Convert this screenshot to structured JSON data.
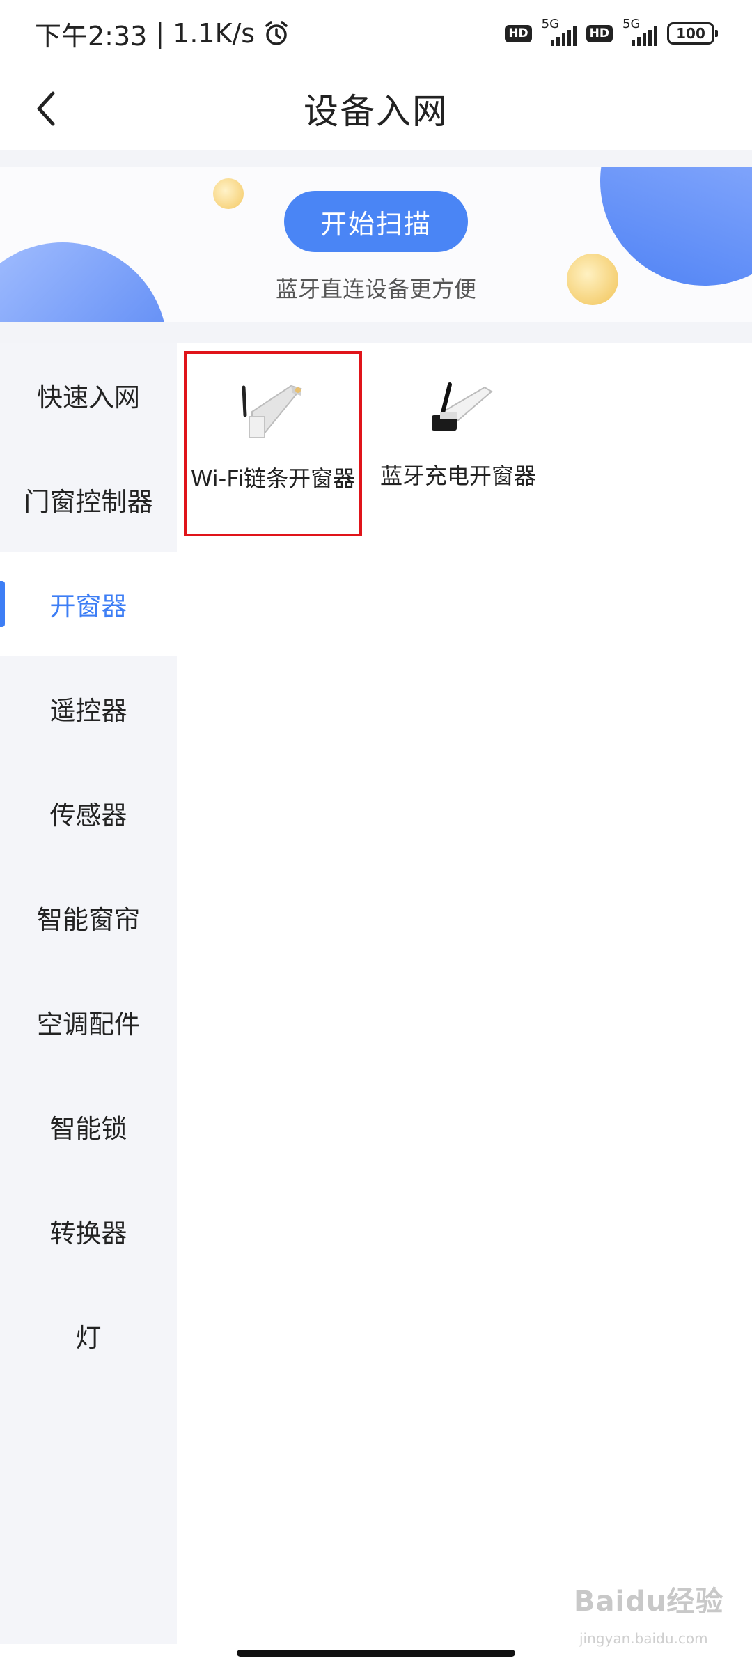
{
  "status_bar": {
    "time": "下午2:33",
    "separator": "|",
    "net_speed": "1.1K/s",
    "hd1": "HD",
    "net1": "5G",
    "hd2": "HD",
    "net2": "5G",
    "battery": "100",
    "icons": [
      "alarm-icon",
      "signal-icon",
      "battery-icon"
    ]
  },
  "header": {
    "title": "设备入网",
    "back_icon": "chevron-left-icon"
  },
  "banner": {
    "scan_button": "开始扫描",
    "hint": "蓝牙直连设备更方便"
  },
  "sidebar": {
    "items": [
      {
        "label": "快速入网",
        "active": false
      },
      {
        "label": "门窗控制器",
        "active": false
      },
      {
        "label": "开窗器",
        "active": true
      },
      {
        "label": "遥控器",
        "active": false
      },
      {
        "label": "传感器",
        "active": false
      },
      {
        "label": "智能窗帘",
        "active": false
      },
      {
        "label": "空调配件",
        "active": false
      },
      {
        "label": "智能锁",
        "active": false
      },
      {
        "label": "转换器",
        "active": false
      },
      {
        "label": "灯",
        "active": false
      }
    ]
  },
  "devices": [
    {
      "label": "Wi-Fi链条开窗器",
      "highlighted": true,
      "image": "wifi-chain-window-opener-image"
    },
    {
      "label": "蓝牙充电开窗器",
      "highlighted": false,
      "image": "bluetooth-charging-window-opener-image"
    }
  ],
  "watermark": {
    "text": "Baidu经验",
    "sub": "jingyan.baidu.com"
  },
  "colors": {
    "accent": "#3d7ef5",
    "highlight_border": "#e0141a",
    "sidebar_bg": "#f4f5f9"
  }
}
